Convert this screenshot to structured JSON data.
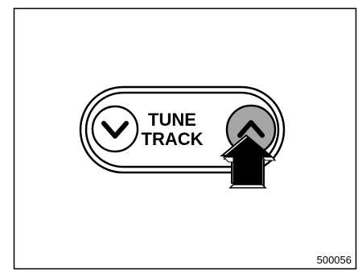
{
  "figure": {
    "code": "500056",
    "panel": {
      "label_line1": "TUNE",
      "label_line2": "TRACK",
      "down_button_icon": "chevron-down-icon",
      "up_button_icon": "chevron-up-icon",
      "pointer_icon": "arrow-up-icon",
      "pressed_button": "up",
      "up_button_fill": "#a6a6a6"
    }
  }
}
